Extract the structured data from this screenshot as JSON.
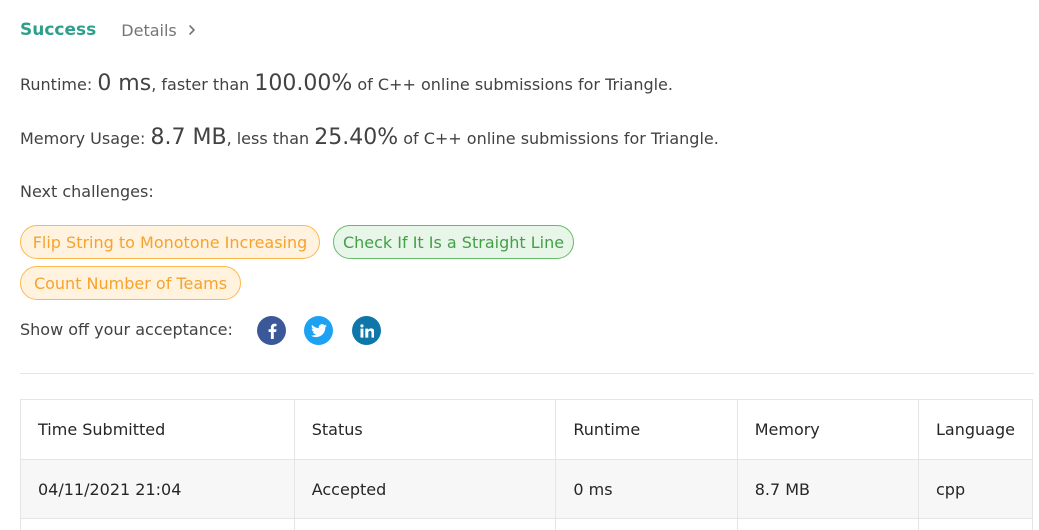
{
  "header": {
    "status": "Success",
    "details": "Details"
  },
  "runtime": {
    "label": "Runtime:",
    "value": "0 ms",
    "mid": ", faster than",
    "percent": "100.00%",
    "suffix": "of C++ online submissions for Triangle."
  },
  "memory": {
    "label": "Memory Usage:",
    "value": "8.7 MB",
    "mid": ", less than",
    "percent": "25.40%",
    "suffix": "of C++ online submissions for Triangle."
  },
  "challenges": {
    "label": "Next challenges:",
    "items": [
      {
        "label": "Flip String to Monotone Increasing",
        "difficulty": "medium"
      },
      {
        "label": "Check If It Is a Straight Line",
        "difficulty": "easy"
      },
      {
        "label": "Count Number of Teams",
        "difficulty": "medium"
      }
    ]
  },
  "share": {
    "label": "Show off your acceptance:",
    "icons": [
      "facebook-icon",
      "twitter-icon",
      "linkedin-icon"
    ]
  },
  "table": {
    "headers": [
      "Time Submitted",
      "Status",
      "Runtime",
      "Memory",
      "Language"
    ],
    "rows": [
      {
        "time": "04/11/2021 21:04",
        "status": "Accepted",
        "runtime": "0 ms",
        "memory": "8.7 MB",
        "language": "cpp"
      }
    ]
  },
  "colors": {
    "accent": "#2e9f8b",
    "medium": "#f7a22c",
    "easy": "#43a047",
    "facebook": "#3b5998",
    "twitter": "#1da1f2",
    "linkedin": "#0e76a8"
  }
}
